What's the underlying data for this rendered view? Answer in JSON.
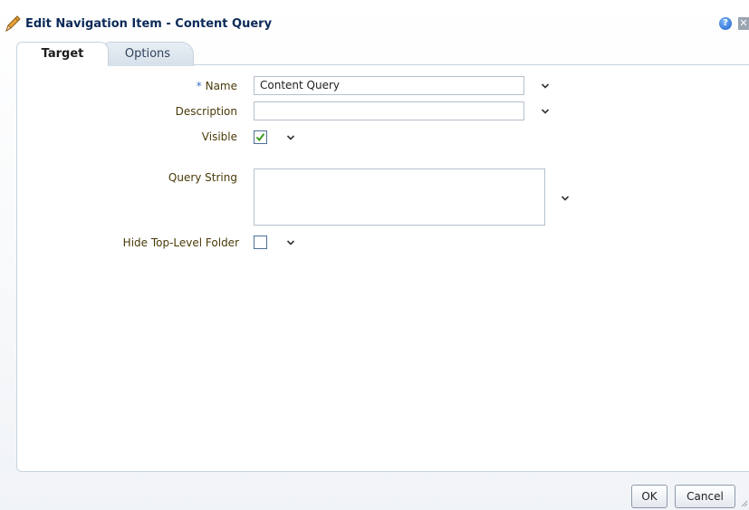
{
  "dialog": {
    "title": "Edit Navigation Item - Content Query",
    "title_icon": "pencil-icon",
    "help_icon": "help-icon",
    "close_icon": "close-icon"
  },
  "tabs": [
    {
      "label": "Target",
      "selected": true
    },
    {
      "label": "Options",
      "selected": false
    }
  ],
  "form": {
    "name": {
      "label": "Name",
      "required_marker": "*",
      "value": "Content Query"
    },
    "description": {
      "label": "Description",
      "value": ""
    },
    "visible": {
      "label": "Visible",
      "checked": true
    },
    "query_string": {
      "label": "Query String",
      "value": ""
    },
    "hide_top_level_folder": {
      "label": "Hide Top-Level Folder",
      "checked": false
    }
  },
  "buttons": {
    "ok": "OK",
    "cancel": "Cancel"
  },
  "colors": {
    "title": "#0b2a58",
    "label": "#4a3a08",
    "required": "#3a6fc4",
    "check": "#3d9a1f"
  }
}
